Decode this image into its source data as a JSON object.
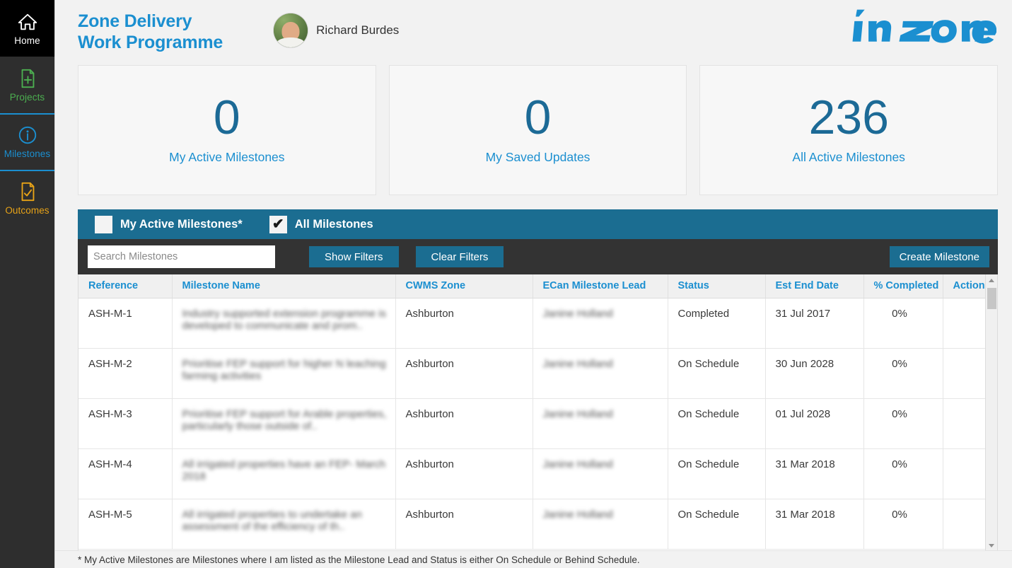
{
  "sidebar": {
    "items": [
      {
        "label": "Home",
        "icon": "home-icon",
        "color": "#ffffff",
        "active": true
      },
      {
        "label": "Projects",
        "icon": "document-plus-icon",
        "color": "#4caf50",
        "active": false
      },
      {
        "label": "Milestones",
        "icon": "info-circle-icon",
        "color": "#1b8fd0",
        "active": false
      },
      {
        "label": "Outcomes",
        "icon": "document-check-icon",
        "color": "#e8a317",
        "active": false
      }
    ]
  },
  "header": {
    "title_line1": "Zone Delivery",
    "title_line2": "Work Programme",
    "user_name": "Richard Burdes",
    "logo_text": "inZone"
  },
  "cards": [
    {
      "value": "0",
      "label": "My Active Milestones"
    },
    {
      "value": "0",
      "label": "My Saved Updates"
    },
    {
      "value": "236",
      "label": "All Active Milestones"
    }
  ],
  "toolbar": {
    "checkbox_my_active_label": "My Active Milestones*",
    "checkbox_my_active_checked": false,
    "checkbox_all_label": "All Milestones",
    "checkbox_all_checked": true,
    "checkbox_all_mark": "✔",
    "search_placeholder": "Search Milestones",
    "search_value": "",
    "show_filters_label": "Show Filters",
    "clear_filters_label": "Clear Filters",
    "create_milestone_label": "Create Milestone"
  },
  "table": {
    "columns": [
      "Reference",
      "Milestone Name",
      "CWMS Zone",
      "ECan Milestone Lead",
      "Status",
      "Est End Date",
      "% Completed",
      "Actions"
    ],
    "rows": [
      {
        "reference": "ASH-M-1",
        "milestone_name": "Industry supported extension programme is developed to communicate and prom..",
        "cwms_zone": "Ashburton",
        "lead": "Janine Holland",
        "status": "Completed",
        "est_end_date": "31 Jul 2017",
        "percent_completed": "0%",
        "actions": ""
      },
      {
        "reference": "ASH-M-2",
        "milestone_name": "Prioritise FEP support for higher N leaching farming activities",
        "cwms_zone": "Ashburton",
        "lead": "Janine Holland",
        "status": "On Schedule",
        "est_end_date": "30 Jun 2028",
        "percent_completed": "0%",
        "actions": ""
      },
      {
        "reference": "ASH-M-3",
        "milestone_name": "Prioritise FEP support for Arable properties, particularly those outside of..",
        "cwms_zone": "Ashburton",
        "lead": "Janine Holland",
        "status": "On Schedule",
        "est_end_date": "01 Jul 2028",
        "percent_completed": "0%",
        "actions": ""
      },
      {
        "reference": "ASH-M-4",
        "milestone_name": "All irrigated properties have an FEP- March 2018",
        "cwms_zone": "Ashburton",
        "lead": "Janine Holland",
        "status": "On Schedule",
        "est_end_date": "31 Mar 2018",
        "percent_completed": "0%",
        "actions": ""
      },
      {
        "reference": "ASH-M-5",
        "milestone_name": "All irrigated properties to undertake an assessment of the efficiency of th..",
        "cwms_zone": "Ashburton",
        "lead": "Janine Holland",
        "status": "On Schedule",
        "est_end_date": "31 Mar 2018",
        "percent_completed": "0%",
        "actions": ""
      }
    ]
  },
  "footnote": "* My Active Milestones are Milestones where I am listed as the Milestone Lead and Status is either On Schedule or Behind Schedule.",
  "colors": {
    "brand_blue": "#1b8fd0",
    "header_teal": "#1b6d91",
    "toolbar_dark": "#333333",
    "sidebar_dark": "#2e2e2e",
    "projects_green": "#4caf50",
    "outcomes_orange": "#e8a317"
  }
}
